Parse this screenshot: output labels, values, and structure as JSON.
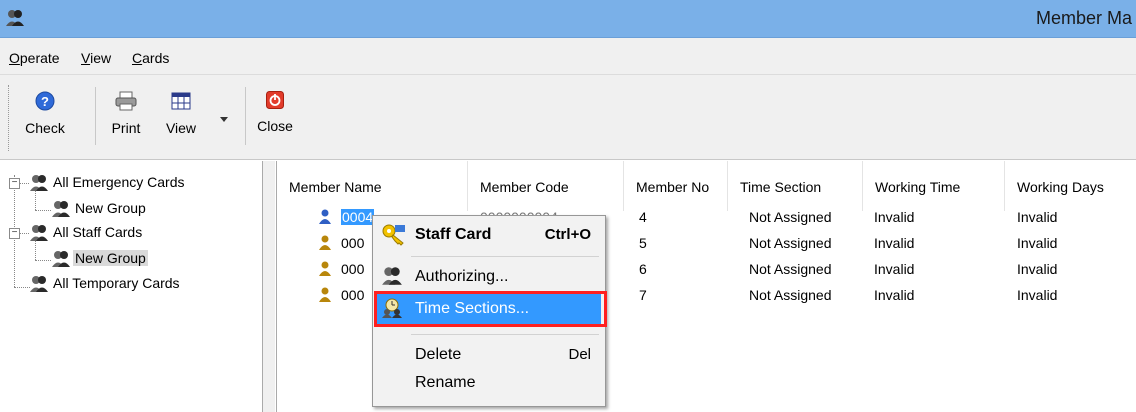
{
  "window": {
    "title": "Member Ma"
  },
  "menu": {
    "operate": "O",
    "operate_rest": "perate",
    "view": "V",
    "view_rest": "iew",
    "cards": "C",
    "cards_rest": "ards"
  },
  "toolbar": {
    "check": "Check",
    "print": "Print",
    "view": "View",
    "close": "Close"
  },
  "tree": {
    "emergency": "All Emergency Cards",
    "emergency_group": "New Group",
    "staff": "All Staff Cards",
    "staff_group": "New Group",
    "temporary": "All Temporary Cards",
    "expander_minus": "−"
  },
  "list": {
    "columns": [
      "Member Name",
      "Member Code",
      "Member No",
      "Time Section",
      "Working Time",
      "Working Days"
    ],
    "rows": [
      {
        "name": "0004",
        "code": "0000000004",
        "no": "4",
        "time_section": "Not Assigned",
        "working_time": "Invalid",
        "working_days": "Invalid"
      },
      {
        "name": "000",
        "no": "5",
        "time_section": "Not Assigned",
        "working_time": "Invalid",
        "working_days": "Invalid"
      },
      {
        "name": "000",
        "no": "6",
        "time_section": "Not Assigned",
        "working_time": "Invalid",
        "working_days": "Invalid"
      },
      {
        "name": "000",
        "no": "7",
        "time_section": "Not Assigned",
        "working_time": "Invalid",
        "working_days": "Invalid"
      }
    ]
  },
  "context_menu": {
    "staff_card": "Staff Card",
    "staff_card_shortcut": "Ctrl+O",
    "authorizing": "Authorizing...",
    "time_sections": "Time Sections...",
    "delete": "Delete",
    "delete_shortcut": "Del",
    "rename": "Rename"
  },
  "colors": {
    "titlebar": "#7ab0e8",
    "selection": "#3399ff",
    "highlight_box": "#ff2020"
  }
}
